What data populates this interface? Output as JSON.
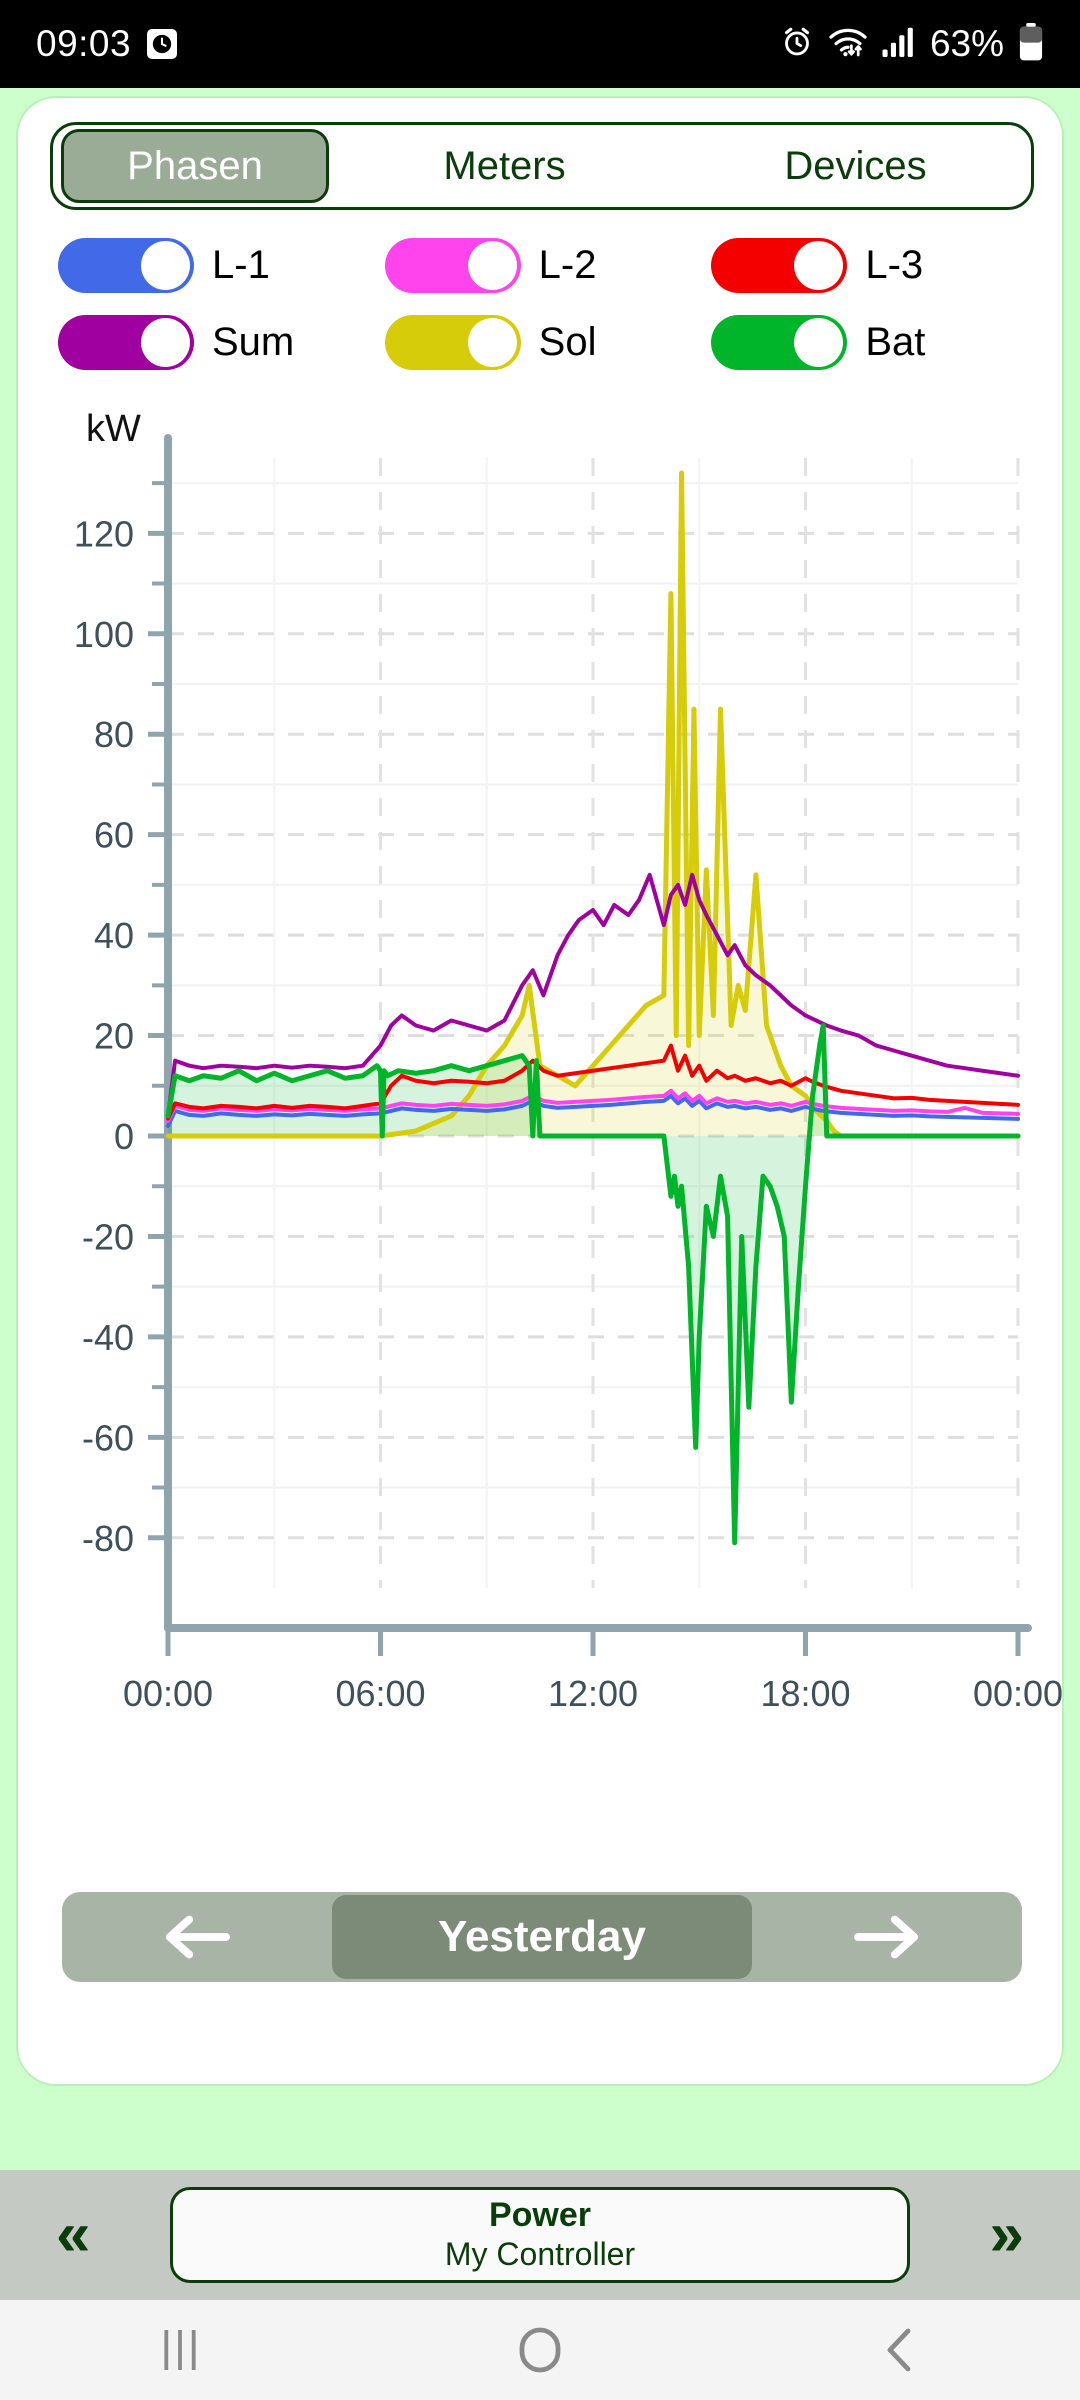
{
  "statusbar": {
    "time": "09:03",
    "battery": "63%",
    "icons": [
      "screenshot-icon",
      "alarm-icon",
      "wifi-icon",
      "signal-icon",
      "battery-icon"
    ]
  },
  "tabs": [
    {
      "label": "Phasen",
      "active": true
    },
    {
      "label": "Meters",
      "active": false
    },
    {
      "label": "Devices",
      "active": false
    }
  ],
  "toggles": [
    {
      "label": "L-1",
      "color": "#4169e8",
      "on": true
    },
    {
      "label": "L-2",
      "color": "#ff44ee",
      "on": true
    },
    {
      "label": "L-3",
      "color": "#f40000",
      "on": true
    },
    {
      "label": "Sum",
      "color": "#a0009f",
      "on": true
    },
    {
      "label": "Sol",
      "color": "#d6cc0a",
      "on": true
    },
    {
      "label": "Bat",
      "color": "#00b52a",
      "on": true
    }
  ],
  "daynav": {
    "prev_icon": "arrow-left-icon",
    "label": "Yesterday",
    "next_icon": "arrow-right-icon"
  },
  "bottombar": {
    "prev_icon": "double-chevron-left-icon",
    "title": "Power",
    "subtitle": "My Controller",
    "next_icon": "double-chevron-right-icon"
  },
  "androidnav": {
    "recents": "recents-icon",
    "home": "home-icon",
    "back": "back-icon"
  },
  "chart_data": {
    "type": "line",
    "title": "",
    "xlabel": "",
    "ylabel": "kW",
    "unit": "kW",
    "ylim": [
      -90,
      135
    ],
    "yticks": [
      120,
      100,
      80,
      60,
      40,
      20,
      0,
      -20,
      -40,
      -60,
      -80
    ],
    "yminor_step": 10,
    "xlim": [
      0,
      24
    ],
    "xticks": [
      "00:00",
      "06:00",
      "12:00",
      "18:00",
      "00:00"
    ],
    "xtick_hours": [
      0,
      6,
      12,
      18,
      24
    ],
    "grid": true,
    "legend": "toggle-switches-above",
    "series": [
      {
        "name": "L-1",
        "color": "#4169e8",
        "x": [
          0,
          0.2,
          0.6,
          1,
          1.5,
          2,
          2.5,
          3,
          3.5,
          4,
          4.5,
          5,
          5.5,
          6,
          6.3,
          6.6,
          7,
          7.5,
          8,
          8.5,
          9,
          9.5,
          10,
          10.3,
          10.6,
          11,
          11.5,
          12,
          12.5,
          13,
          13.5,
          14,
          14.2,
          14.4,
          14.6,
          14.8,
          15,
          15.2,
          15.5,
          15.8,
          16,
          16.3,
          16.6,
          17,
          17.3,
          17.6,
          18,
          18.2,
          18.5,
          19,
          19.5,
          20,
          20.5,
          21,
          21.5,
          22,
          22.5,
          23,
          23.5,
          24
        ],
        "y": [
          2,
          5,
          4.2,
          4,
          4.5,
          4.2,
          4,
          4.3,
          4.1,
          4.4,
          4.2,
          4,
          4.3,
          4.5,
          5,
          5.5,
          5.2,
          5,
          5.4,
          5.2,
          5,
          5.3,
          6,
          7,
          6,
          5.6,
          5.8,
          6,
          6.2,
          6.5,
          6.8,
          7,
          8,
          6.5,
          7.5,
          6,
          7,
          5.5,
          6.5,
          5.8,
          6,
          5.5,
          5.8,
          5.2,
          5.5,
          5,
          5.8,
          5.4,
          5,
          4.6,
          4.4,
          4.2,
          4,
          4.1,
          3.9,
          3.8,
          3.7,
          3.6,
          3.5,
          3.4
        ]
      },
      {
        "name": "L-2",
        "color": "#ff44ee",
        "x": [
          0,
          0.2,
          0.6,
          1,
          1.5,
          2,
          2.5,
          3,
          3.5,
          4,
          4.5,
          5,
          5.5,
          6,
          6.3,
          6.6,
          7,
          7.5,
          8,
          8.5,
          9,
          9.5,
          10,
          10.3,
          10.6,
          11,
          11.5,
          12,
          12.5,
          13,
          13.5,
          14,
          14.2,
          14.4,
          14.6,
          14.8,
          15,
          15.2,
          15.5,
          15.8,
          16,
          16.3,
          16.6,
          17,
          17.3,
          17.6,
          18,
          18.2,
          18.5,
          19,
          19.5,
          20,
          20.5,
          21,
          21.5,
          22,
          22.5,
          23,
          23.5,
          24
        ],
        "y": [
          3,
          6,
          5.2,
          5,
          5.5,
          5.2,
          5,
          5.3,
          5.1,
          5.4,
          5.2,
          5,
          5.3,
          5.5,
          6,
          6.5,
          6.2,
          6,
          6.4,
          6.2,
          6,
          6.3,
          7,
          8,
          7,
          6.6,
          6.8,
          7,
          7.2,
          7.5,
          7.8,
          8,
          9,
          7.5,
          8.5,
          7,
          8,
          6.5,
          7.5,
          6.8,
          7,
          6.5,
          6.8,
          6.2,
          6.5,
          6,
          6.8,
          6.4,
          6,
          5.6,
          5.4,
          5.2,
          5,
          5.1,
          4.9,
          4.8,
          5.6,
          4.6,
          4.5,
          4.4
        ]
      },
      {
        "name": "L-3",
        "color": "#f40000",
        "x": [
          0,
          0.2,
          0.6,
          1,
          1.5,
          2,
          2.5,
          3,
          3.5,
          4,
          4.5,
          5,
          5.5,
          6,
          6.3,
          6.6,
          7,
          7.5,
          8,
          8.5,
          9,
          9.5,
          10,
          10.3,
          10.6,
          11,
          11.5,
          12,
          12.5,
          13,
          13.5,
          14,
          14.2,
          14.4,
          14.6,
          14.8,
          15,
          15.2,
          15.5,
          15.8,
          16,
          16.3,
          16.6,
          17,
          17.3,
          17.6,
          18,
          18.2,
          18.5,
          19,
          19.5,
          20,
          20.5,
          21,
          21.5,
          22,
          22.5,
          23,
          23.5,
          24
        ],
        "y": [
          3.5,
          6.5,
          5.8,
          5.5,
          6,
          5.8,
          5.5,
          6,
          5.6,
          6,
          5.8,
          5.5,
          6,
          6.5,
          10,
          12,
          11,
          10.5,
          11,
          10.8,
          10.5,
          11,
          13,
          15,
          13,
          12,
          12.5,
          13,
          13.5,
          14,
          14.5,
          15,
          18,
          13,
          16,
          12,
          14,
          11,
          13,
          11.5,
          12,
          11,
          11.5,
          10.5,
          11,
          10,
          11.5,
          10.8,
          10,
          9,
          8.5,
          8,
          7.5,
          7.6,
          7.2,
          7,
          6.8,
          6.6,
          6.4,
          6.2
        ]
      },
      {
        "name": "Sum",
        "color": "#a0009f",
        "x": [
          0,
          0.2,
          0.6,
          1,
          1.5,
          2,
          2.5,
          3,
          3.5,
          4,
          4.5,
          5,
          5.5,
          6,
          6.3,
          6.6,
          7,
          7.5,
          8,
          8.5,
          9,
          9.5,
          10,
          10.3,
          10.6,
          11,
          11.3,
          11.6,
          12,
          12.3,
          12.6,
          13,
          13.3,
          13.6,
          14,
          14.2,
          14.4,
          14.6,
          14.8,
          15,
          15.2,
          15.5,
          15.8,
          16,
          16.3,
          16.6,
          17,
          17.3,
          17.6,
          18,
          18.3,
          18.6,
          19,
          19.5,
          20,
          20.5,
          21,
          21.5,
          22,
          22.5,
          23,
          23.5,
          24
        ],
        "y": [
          4,
          15,
          14,
          13.5,
          14,
          13.8,
          13.5,
          14,
          13.6,
          14,
          13.8,
          13.5,
          14,
          18,
          22,
          24,
          22,
          21,
          23,
          22,
          21,
          23,
          30,
          33,
          28,
          36,
          40,
          43,
          45,
          42,
          46,
          44,
          47,
          52,
          42,
          48,
          50,
          46,
          52,
          47,
          44,
          40,
          36,
          38,
          34,
          32,
          30,
          28,
          26,
          24,
          23,
          22,
          21,
          20,
          18,
          17,
          16,
          15,
          14,
          13.5,
          13,
          12.5,
          12
        ]
      },
      {
        "name": "Sol",
        "color": "#d6cc0a",
        "x": [
          0,
          2,
          4,
          6,
          7,
          8,
          8.5,
          9,
          9.5,
          10,
          10.2,
          10.5,
          11,
          11.5,
          12,
          12.5,
          13,
          13.5,
          14,
          14.2,
          14.35,
          14.5,
          14.7,
          14.85,
          15,
          15.2,
          15.4,
          15.6,
          15.9,
          16.1,
          16.3,
          16.6,
          16.9,
          17.1,
          17.3,
          17.6,
          18,
          18.3,
          18.6,
          18.8,
          19,
          19.2,
          19.5,
          20,
          22,
          24
        ],
        "y": [
          0,
          0,
          0,
          0,
          1,
          4,
          8,
          14,
          18,
          24,
          30,
          14,
          12,
          10,
          14,
          18,
          22,
          26,
          28,
          108,
          20,
          132,
          18,
          85,
          20,
          53,
          24,
          85,
          22,
          30,
          25,
          52,
          22,
          18,
          14,
          10,
          8,
          5,
          3,
          1,
          0,
          0,
          0,
          0,
          0,
          0
        ]
      },
      {
        "name": "Bat",
        "color": "#00b52a",
        "x": [
          0,
          0.2,
          0.6,
          1,
          1.5,
          2,
          2.5,
          3,
          3.5,
          4,
          4.5,
          5,
          5.5,
          5.9,
          6,
          6.05,
          6.1,
          6.2,
          6.5,
          7,
          7.5,
          8,
          8.5,
          9,
          9.5,
          10,
          10.2,
          10.3,
          10.4,
          10.5,
          10.8,
          11,
          11.5,
          12,
          12.5,
          13,
          13.5,
          14,
          14.1,
          14.2,
          14.3,
          14.4,
          14.5,
          14.6,
          14.7,
          14.9,
          15,
          15.2,
          15.4,
          15.6,
          15.8,
          16,
          16.2,
          16.4,
          16.6,
          16.8,
          17,
          17.2,
          17.4,
          17.6,
          17.8,
          18,
          18.2,
          18.4,
          18.5,
          18.6,
          19,
          20,
          22,
          24
        ],
        "y": [
          4,
          12,
          11,
          12,
          11.5,
          13,
          11,
          12.5,
          11,
          12,
          13,
          11.5,
          12,
          14,
          13,
          0,
          13,
          12,
          13,
          12.5,
          13,
          14,
          13,
          14,
          15,
          16,
          14,
          0,
          15,
          0,
          0,
          0,
          0,
          0,
          0,
          0,
          0,
          0,
          -6,
          -12,
          -8,
          -14,
          -10,
          -18,
          -26,
          -62,
          -40,
          -14,
          -20,
          -8,
          -16,
          -81,
          -20,
          -54,
          -26,
          -8,
          -10,
          -14,
          -20,
          -53,
          -30,
          -10,
          8,
          18,
          22,
          0,
          0,
          0,
          0,
          0
        ]
      }
    ]
  }
}
